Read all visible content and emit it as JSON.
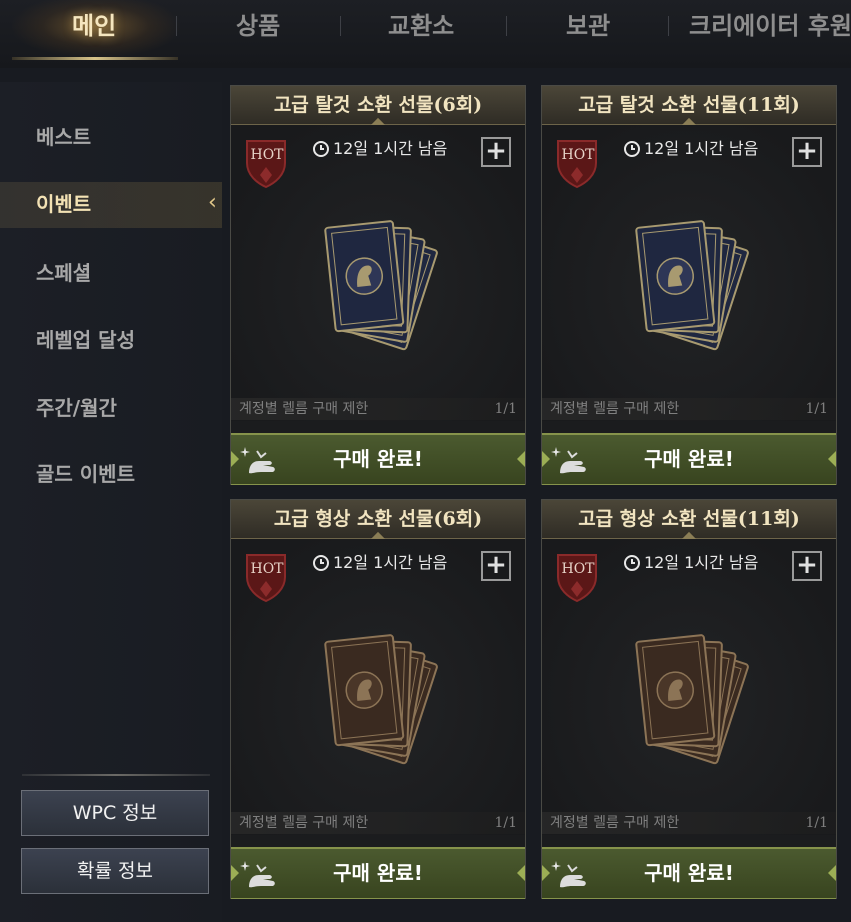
{
  "tabs": [
    {
      "label": "메인"
    },
    {
      "label": "상품"
    },
    {
      "label": "교환소"
    },
    {
      "label": "보관"
    },
    {
      "label": "크리에이터 후원"
    }
  ],
  "sidebar": {
    "items": [
      {
        "label": "베스트"
      },
      {
        "label": "이벤트"
      },
      {
        "label": "스페셜"
      },
      {
        "label": "레벨업 달성"
      },
      {
        "label": "주간/월간"
      },
      {
        "label": "골드 이벤트"
      }
    ],
    "active_index": 1,
    "buttons": {
      "wpc": "WPC 정보",
      "probability": "확률 정보"
    }
  },
  "cards": [
    {
      "title": "고급 탈것 소환 선물(6회)",
      "badge": "HOT",
      "timer": "12일 1시간 남음",
      "limit_label": "계정별 렐름  구매 제한",
      "limit_count": "1/1",
      "button": "구매 완료!",
      "theme": "blue"
    },
    {
      "title": "고급 탈것 소환 선물(11회)",
      "badge": "HOT",
      "timer": "12일 1시간 남음",
      "limit_label": "계정별 렐름  구매 제한",
      "limit_count": "1/1",
      "button": "구매 완료!",
      "theme": "blue"
    },
    {
      "title": "고급 형상 소환 선물(6회)",
      "badge": "HOT",
      "timer": "12일 1시간 남음",
      "limit_label": "계정별 렐름  구매 제한",
      "limit_count": "1/1",
      "button": "구매 완료!",
      "theme": "brown"
    },
    {
      "title": "고급 형상 소환 선물(11회)",
      "badge": "HOT",
      "timer": "12일 1시간 남음",
      "limit_label": "계정별 렐름  구매 제한",
      "limit_count": "1/1",
      "button": "구매 완료!",
      "theme": "brown"
    }
  ],
  "colors": {
    "accent_gold": "#f3e2b4",
    "button_green": "#4b5a2f",
    "hot_red": "#7a2020"
  }
}
